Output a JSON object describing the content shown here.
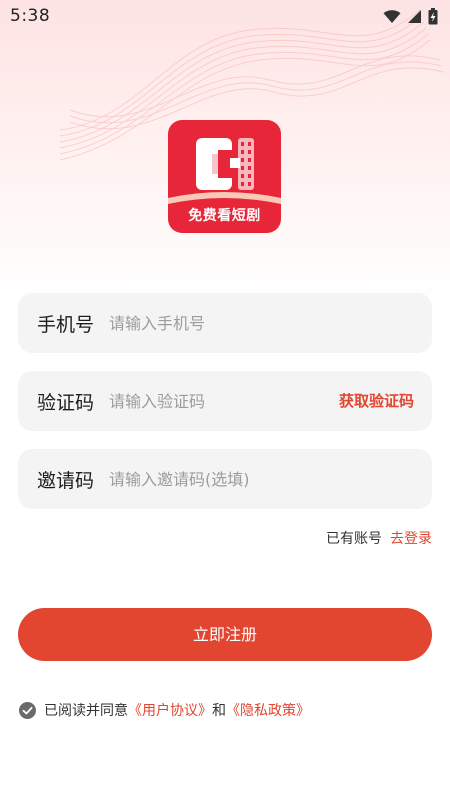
{
  "status_bar": {
    "time": "5:38"
  },
  "logo": {
    "caption": "免费看短剧"
  },
  "form": {
    "phone": {
      "label": "手机号",
      "placeholder": "请输入手机号"
    },
    "code": {
      "label": "验证码",
      "placeholder": "请输入验证码",
      "get_code_label": "获取验证码"
    },
    "invite": {
      "label": "邀请码",
      "placeholder": "请输入邀请码(选填)"
    }
  },
  "login": {
    "question": "已有账号",
    "link": "去登录"
  },
  "register_button": {
    "label": "立即注册"
  },
  "agreement": {
    "prefix": "已阅读并同意",
    "user_agreement": "《用户协议》",
    "conjunction": "和",
    "privacy_policy": "《隐私政策》",
    "checked": true
  },
  "colors": {
    "accent": "#e24530",
    "logo_bg": "#e8263a",
    "field_bg": "#f4f4f4"
  },
  "icons": [
    "wifi-icon",
    "cellular-signal-icon",
    "battery-charging-icon",
    "check-circle-icon"
  ]
}
